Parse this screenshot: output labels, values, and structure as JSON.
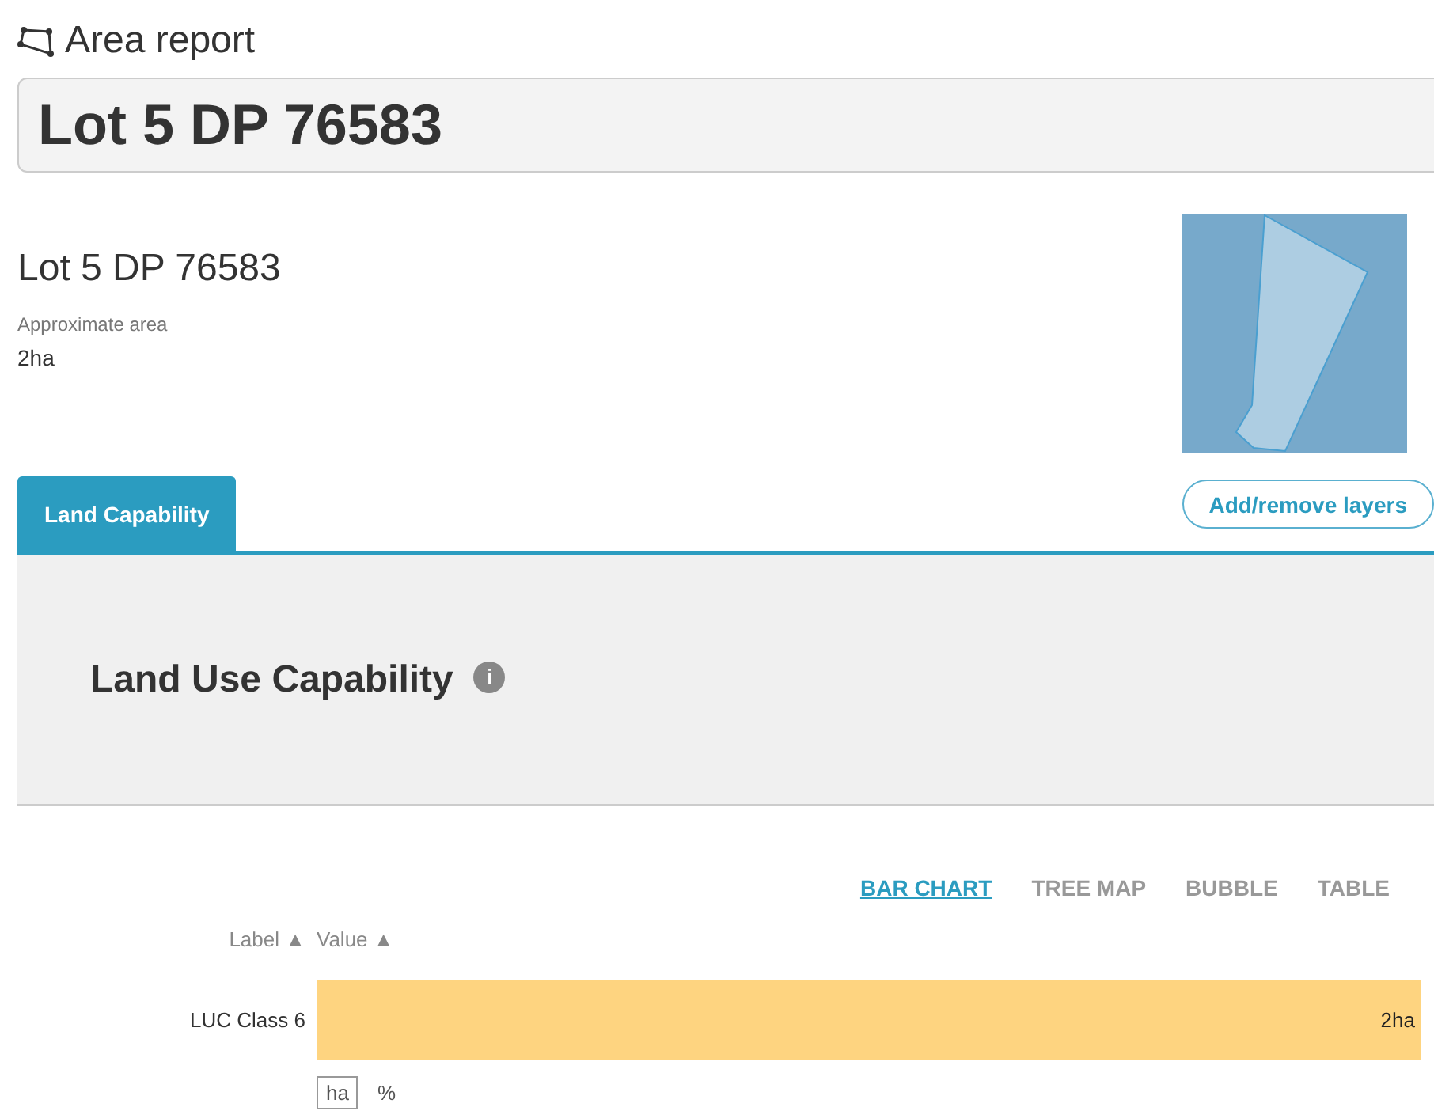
{
  "header": {
    "title": "Area report"
  },
  "search": {
    "value": "Lot 5 DP 76583"
  },
  "summary": {
    "name": "Lot 5 DP 76583",
    "area_label": "Approximate area",
    "area_value": "2ha"
  },
  "tabs": [
    {
      "label": "Land Capability",
      "selected": true
    }
  ],
  "layers_button": {
    "label": "Add/remove layers"
  },
  "panel": {
    "title": "Land Use Capability",
    "info_icon": "i"
  },
  "views": [
    {
      "label": "BAR CHART",
      "selected": true
    },
    {
      "label": "TREE MAP",
      "selected": false
    },
    {
      "label": "BUBBLE",
      "selected": false
    },
    {
      "label": "TABLE",
      "selected": false
    }
  ],
  "columns": [
    {
      "label": "Label ▲"
    },
    {
      "label": "Value ▲"
    }
  ],
  "rows": [
    {
      "label": "LUC Class 6",
      "value": "2ha"
    }
  ],
  "units": [
    {
      "label": "ha",
      "selected": true
    },
    {
      "label": "%",
      "selected": false
    }
  ]
}
